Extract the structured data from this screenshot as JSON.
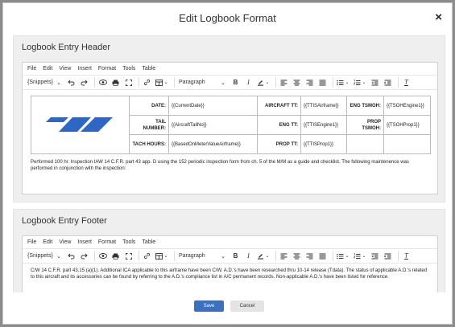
{
  "dialog": {
    "title": "Edit Logbook Format",
    "close_glyph": "×"
  },
  "header_section": {
    "title": "Logbook Entry Header",
    "menu": [
      "File",
      "Edit",
      "View",
      "Insert",
      "Format",
      "Tools",
      "Table"
    ],
    "toolbar": {
      "snippets": "{Snippets}",
      "format": "Paragraph",
      "chevron": "⌄"
    },
    "table": {
      "rows": [
        [
          {
            "label": "DATE:",
            "value": "{{CurrentDate}}"
          },
          {
            "label": "AIRCRAFT TT:",
            "value": "{{TTISAirframe}}"
          },
          {
            "label": "ENG TSMOH:",
            "value": "{{TSOHEngine1}}"
          }
        ],
        [
          {
            "label": "TAIL NUMBER:",
            "value": "{{AircraftTailNo}}"
          },
          {
            "label": "ENG TT:",
            "value": "{{TTISEngine1}}"
          },
          {
            "label": "PROP TSMOH:",
            "value": "{{TSOHProp1}}"
          }
        ],
        [
          {
            "label": "TACH HOURS:",
            "value": "{{BasedOnMeterValueAirframe}}"
          },
          {
            "label": "PROP TT:",
            "value": "{{TTISProp1}}"
          },
          {
            "label": "",
            "value": ""
          }
        ]
      ]
    },
    "body_text": "Performed 100 hr. Inspection IAW 14 C.F.R. part 43 app. D using the 152 periodic inspection form from ch. 5 of the M/M as a guide and checklist. The following maintenence was performed in conjunction with the inspection:"
  },
  "footer_section": {
    "title": "Logbook Entry Footer",
    "menu": [
      "File",
      "Edit",
      "View",
      "Insert",
      "Format",
      "Tools",
      "Table"
    ],
    "toolbar": {
      "snippets": "{Snippets}",
      "format": "Paragraph",
      "chevron": "⌄"
    },
    "body_text": "C/W 14 C.F.R. part 43.15 (a)(1). Additional ICA applicable to this airframe have been C/W. A.D.'s have been researched thru 10-14 release (Tdata). The status of applicable A.D.'s related to this aircraft and its accessories can be found by referring to the A.D.'s compliance list in A/C permanent records. Non-applicable A.D.'s have been listed for reference."
  },
  "buttons": {
    "save": "Save",
    "cancel": "Cancel"
  },
  "colors": {
    "primary": "#3b6fc0",
    "logo": "#2e66c4"
  }
}
